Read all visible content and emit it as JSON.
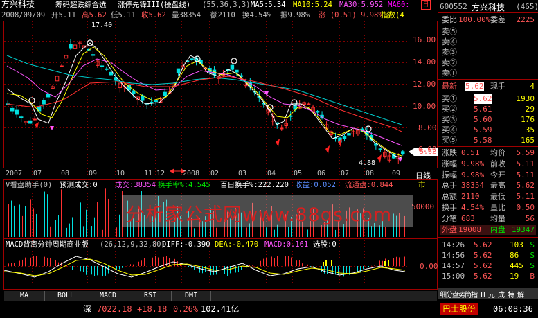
{
  "title_bar": {
    "stock_name": "方兴科技",
    "indicator_name": "筹码超跌综合选",
    "formula": "涨停先锋III(操盘线)",
    "params": "(55,36,3,3)",
    "ma5": "MA5:5.34",
    "ma10": "MA10:5.24",
    "ma30": "MA30:5.952",
    "ma60": "MA60:",
    "close_btn": "日"
  },
  "info_bar": {
    "date": "2008/09/09",
    "open": "开5.11",
    "high": "高5.62",
    "low": "低5.11",
    "close": "收5.62",
    "volume": "量38354",
    "amount": "额2110",
    "turnover": "换4.54%",
    "amplitude": "振9.98%",
    "change": "涨 (0.51) 9.98%",
    "index": "指数(4"
  },
  "main_chart": {
    "price_levels": [
      "16.00",
      "14.00",
      "12.00",
      "10.00",
      "8.00",
      "6.00"
    ],
    "peak_label": "17.40",
    "low_label": "4.88",
    "last_price": "5.62",
    "months": [
      "2007",
      "07",
      "08",
      "09",
      "10",
      "11",
      "12",
      "2008",
      "02",
      "03",
      "04",
      "05",
      "06",
      "07",
      "08",
      "09"
    ],
    "period_label": "日线"
  },
  "vol_panel": {
    "title": "V看盘助手(0)",
    "predict": "预测成交:0",
    "volume": "成交:38354",
    "turnover_rate": "换手率%:4.545",
    "hundred_day": "百日换手%:222.220",
    "income": "收益:0.052",
    "float": "流通盘:0.844",
    "market": "市",
    "axis_label": "50000",
    "watermark": "分析家公式网www.88gs.com"
  },
  "macd_panel": {
    "title": "MACD背离分钟周期商业版",
    "params": "(26,12,9,32,80)",
    "diff": "DIFF:-0.390",
    "dea": "DEA:-0.470",
    "macd": "MACD:0.161",
    "select": "选股:0",
    "axis_label": "0.00"
  },
  "tabs": [
    "MA",
    "BOLL",
    "MACD",
    "RSI",
    "DMI"
  ],
  "right_panel": {
    "code": "600552",
    "name": "方兴科技",
    "count": "(465)",
    "weibi": "委比",
    "weibi_val": "100.00%",
    "weicha": "委差",
    "weicha_val": "2225",
    "sells": [
      "卖⑤",
      "卖④",
      "卖③",
      "卖②",
      "卖①"
    ],
    "latest_label": "最新",
    "latest_val": "5.62",
    "now_hand_label": "现手",
    "now_hand_val": "4",
    "buys": [
      {
        "label": "买①",
        "price": "5.62",
        "vol": "1930"
      },
      {
        "label": "买②",
        "price": "5.61",
        "vol": "29"
      },
      {
        "label": "买③",
        "price": "5.60",
        "vol": "176"
      },
      {
        "label": "买④",
        "price": "5.59",
        "vol": "35"
      },
      {
        "label": "买⑤",
        "price": "5.58",
        "vol": "165"
      }
    ],
    "stats": [
      {
        "l1": "涨跌",
        "v1": "0.51",
        "l2": "均价",
        "v2": "5.59"
      },
      {
        "l1": "涨幅",
        "v1": "9.98%",
        "l2": "前收",
        "v2": "5.11"
      },
      {
        "l1": "振幅",
        "v1": "9.98%",
        "l2": "今开",
        "v2": "5.11"
      },
      {
        "l1": "总手",
        "v1": "38354",
        "l2": "最高",
        "v2": "5.62"
      },
      {
        "l1": "总额",
        "v1": "2110",
        "l2": "最低",
        "v2": "5.11"
      },
      {
        "l1": "换手",
        "v1": "4.54%",
        "l2": "量比",
        "v2": "0.50"
      },
      {
        "l1": "分笔",
        "v1": "683",
        "l2": "均量",
        "v2": "56"
      }
    ],
    "outer_label": "外盘",
    "outer_val": "19008",
    "inner_label": "内盘",
    "inner_val": "19347",
    "ticks": [
      {
        "time": "14:26",
        "price": "5.62",
        "vol": "103",
        "dir": "S"
      },
      {
        "time": "14:56",
        "price": "5.62",
        "vol": "86",
        "dir": "S"
      },
      {
        "time": "14:57",
        "price": "5.62",
        "vol": "445",
        "dir": "S"
      },
      {
        "time": "15:00",
        "price": "5.62",
        "vol": "19",
        "dir": "B"
      }
    ],
    "tabs_label": "细分盘势筒指 Ⅲ 元 成 特 解"
  },
  "status_bar": {
    "market": "深",
    "index": "7022.18",
    "change": "+18.18",
    "pct": "0.26%",
    "amount": "102.41亿",
    "ticker": "巴士股份",
    "time": "06:08:36"
  },
  "colors": {
    "up": "#ff5555",
    "down": "#00e000",
    "grid": "#800000",
    "bg": "#000000"
  }
}
